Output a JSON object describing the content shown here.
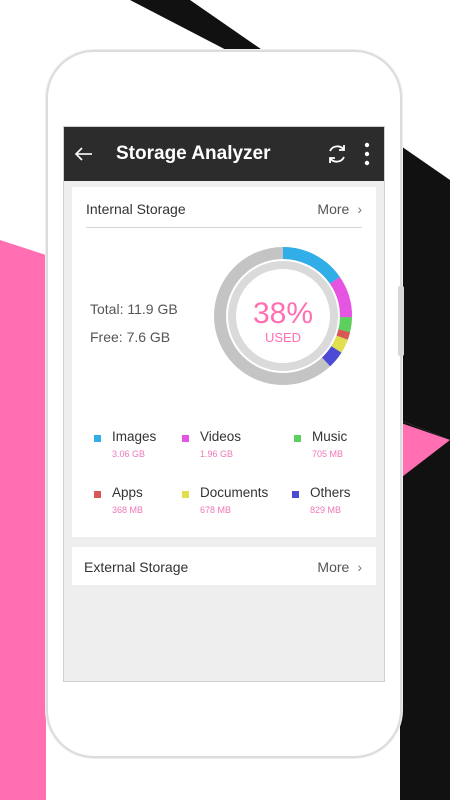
{
  "app": {
    "title": "Storage Analyzer"
  },
  "internal": {
    "title": "Internal Storage",
    "more_label": "More",
    "total": "Total: 11.9 GB",
    "free": "Free: 7.6 GB",
    "used_percent": "38%",
    "used_label": "USED",
    "used_fraction": 0.38
  },
  "categories": [
    {
      "name": "Images",
      "size": "3.06 GB",
      "color": "#31aee8"
    },
    {
      "name": "Videos",
      "size": "1.96 GB",
      "color": "#e654e2"
    },
    {
      "name": "Music",
      "size": "705 MB",
      "color": "#5ccf5c"
    },
    {
      "name": "Apps",
      "size": "368 MB",
      "color": "#d95757"
    },
    {
      "name": "Documents",
      "size": "678 MB",
      "color": "#e0df50"
    },
    {
      "name": "Others",
      "size": "829 MB",
      "color": "#4b4bd6"
    }
  ],
  "external": {
    "title": "External Storage",
    "more_label": "More"
  },
  "colors": {
    "accent_pink": "#ff6fb2",
    "toolbar_bg": "#2c2c2c",
    "ring_gray": "#c4c4c4"
  },
  "icons": {
    "back": "arrow-left-icon",
    "refresh": "refresh-icon",
    "menu": "more-vertical-icon",
    "chevron": "chevron-right-icon"
  }
}
